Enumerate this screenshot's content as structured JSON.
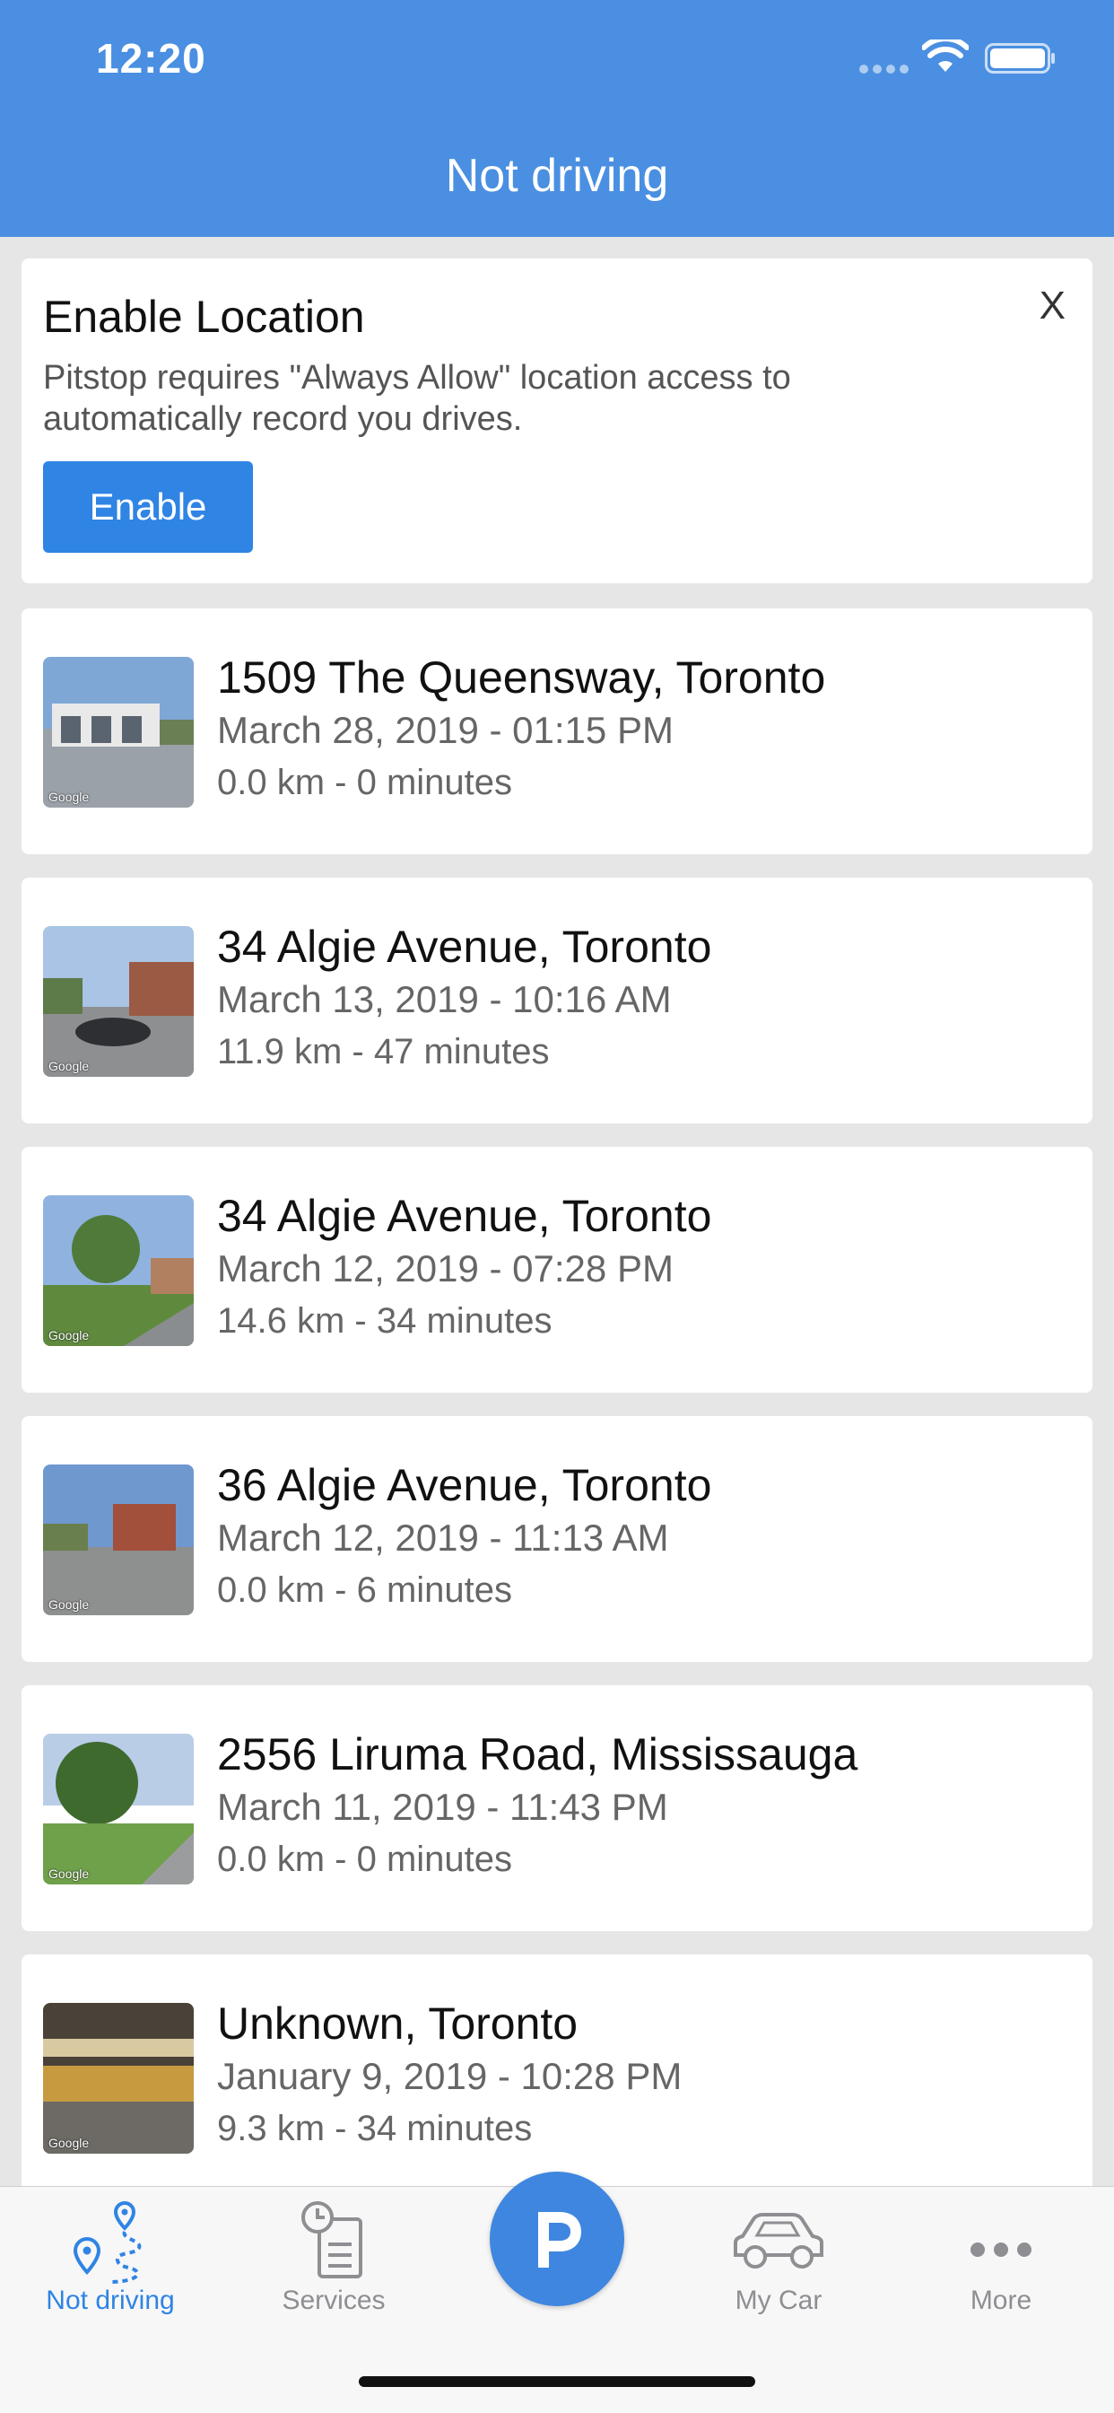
{
  "status_bar": {
    "time": "12:20"
  },
  "header": {
    "title": "Not driving"
  },
  "location_banner": {
    "title": "Enable Location",
    "close_label": "X",
    "message": "Pitstop requires \"Always Allow\" location access to automatically record you drives.",
    "button_label": "Enable"
  },
  "thumb_brand": "Google",
  "trips": [
    {
      "title": "1509 The Queensway, Toronto",
      "date": "March 28, 2019 - 01:15 PM",
      "stats": "0.0 km - 0 minutes"
    },
    {
      "title": "34 Algie Avenue, Toronto",
      "date": "March 13, 2019 - 10:16 AM",
      "stats": "11.9 km - 47 minutes"
    },
    {
      "title": "34 Algie Avenue, Toronto",
      "date": "March 12, 2019 - 07:28 PM",
      "stats": "14.6 km - 34 minutes"
    },
    {
      "title": "36 Algie Avenue, Toronto",
      "date": "March 12, 2019 - 11:13 AM",
      "stats": "0.0 km - 6 minutes"
    },
    {
      "title": "2556 Liruma Road, Mississauga",
      "date": "March 11, 2019 - 11:43 PM",
      "stats": "0.0 km - 0 minutes"
    },
    {
      "title": "Unknown, Toronto",
      "date": "January 9, 2019 - 10:28 PM",
      "stats": "9.3 km - 34 minutes"
    }
  ],
  "tabbar": {
    "tabs": [
      {
        "label": "Not driving",
        "icon": "route-pin-icon",
        "active": true
      },
      {
        "label": "Services",
        "icon": "clipboard-clock-icon",
        "active": false
      },
      {
        "label": "P",
        "icon": "parking-icon",
        "active": false
      },
      {
        "label": "My Car",
        "icon": "car-icon",
        "active": false
      },
      {
        "label": "More",
        "icon": "more-dots-icon",
        "active": false
      }
    ]
  },
  "colors": {
    "header_bg": "#4a8fe1",
    "accent": "#2f84e4",
    "inactive": "#8e8e93"
  }
}
